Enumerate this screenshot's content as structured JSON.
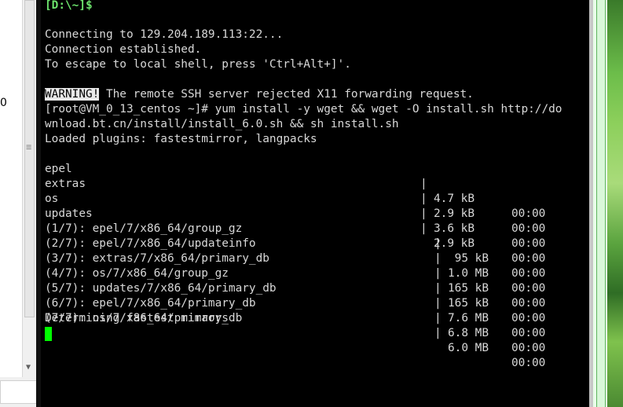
{
  "left": {
    "partial_digit": "0",
    "grip_glyph": "≡",
    "scroll_down_glyph": "▼"
  },
  "terminal": {
    "prompt_line": "[D:\\~]$",
    "connect_lines": [
      "Connecting to 129.204.189.113:22...",
      "Connection established.",
      "To escape to local shell, press 'Ctrl+Alt+]'."
    ],
    "warning_badge": "WARNING!",
    "warning_text": " The remote SSH server rejected X11 forwarding request.",
    "command_line_1": "[root@VM_0_13_centos ~]# yum install -y wget && wget -O install.sh http://do",
    "command_line_2": "wnload.bt.cn/install/install_6.0.sh && sh install.sh",
    "loaded_plugins": "Loaded plugins: fastestmirror, langpacks",
    "repos": [
      {
        "name": "epel",
        "size": "4.7 kB",
        "time": "00:00"
      },
      {
        "name": "extras",
        "size": "2.9 kB",
        "time": "00:00"
      },
      {
        "name": "os",
        "size": "3.6 kB",
        "time": "00:00"
      },
      {
        "name": "updates",
        "size": "2.9 kB",
        "time": "00:00"
      }
    ],
    "downloads": [
      {
        "name": "(1/7): epel/7/x86_64/group_gz",
        "size": " 95 kB",
        "time": "00:00"
      },
      {
        "name": "(2/7): epel/7/x86_64/updateinfo",
        "size": "1.0 MB",
        "time": "00:00"
      },
      {
        "name": "(3/7): extras/7/x86_64/primary_db",
        "size": "165 kB",
        "time": "00:00"
      },
      {
        "name": "(4/7): os/7/x86_64/group_gz",
        "size": "165 kB",
        "time": "00:00"
      },
      {
        "name": "(5/7): updates/7/x86_64/primary_db",
        "size": "7.6 MB",
        "time": "00:00"
      },
      {
        "name": "(6/7): epel/7/x86_64/primary_db",
        "size": "6.8 MB",
        "time": "00:00"
      },
      {
        "name": "(7/7): os/7/x86_64/primary_db",
        "size": "6.0 MB",
        "time": "00:00"
      }
    ],
    "status_line": "Determining fastest mirrors",
    "separator": "|"
  },
  "colors": {
    "terminal_bg": "#000000",
    "text": "#d8d8d8",
    "prompt": "#6ce36c",
    "cursor": "#00ff00"
  }
}
